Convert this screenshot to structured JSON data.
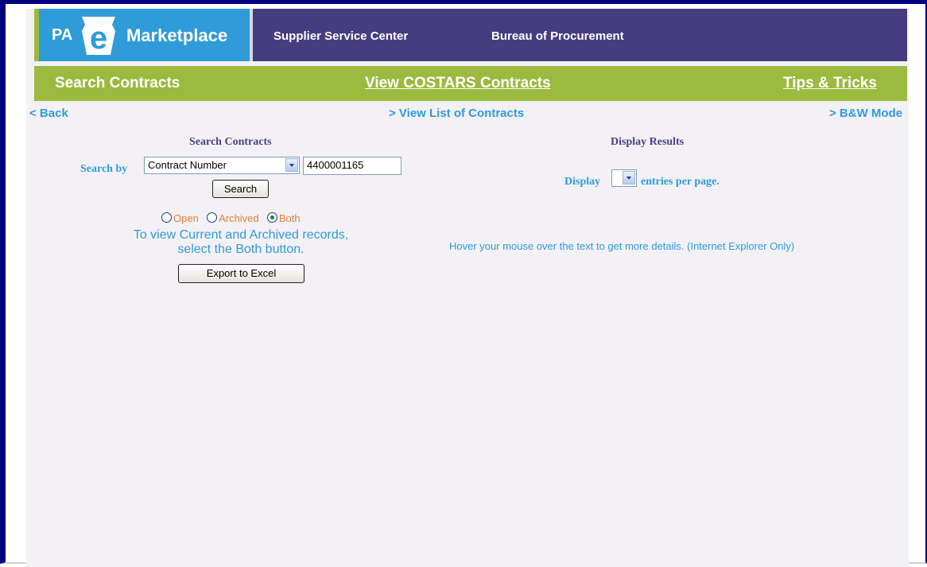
{
  "header": {
    "logo_pa": "PA",
    "logo_e": "e",
    "logo_marketplace": "Marketplace",
    "supplier_service_center": "Supplier Service Center",
    "bureau_of_procurement": "Bureau of Procurement"
  },
  "greenbar": {
    "search_contracts": "Search Contracts",
    "view_costars": "View COSTARS Contracts",
    "tips_tricks": "Tips & Tricks"
  },
  "subnav": {
    "back": "< Back",
    "view_list": "> View List of Contracts",
    "bw_mode": "> B&W Mode"
  },
  "search": {
    "heading": "Search Contracts",
    "search_by_label": "Search by",
    "search_by_value": "Contract Number",
    "input_value": "4400001165",
    "search_button": "Search",
    "radio_open": "Open",
    "radio_archived": "Archived",
    "radio_both": "Both",
    "selected_radio": "Both",
    "info_line1": "To view Current and Archived records,",
    "info_line2": "select the Both button.",
    "export_button": "Export to Excel"
  },
  "display": {
    "heading": "Display Results",
    "display_label": "Display",
    "entries_label": "entries per page.",
    "hover_note": "Hover your mouse over the text to get more details. (Internet Explorer Only)"
  },
  "colors": {
    "frame": "#000080",
    "header_bg": "#453d7f",
    "logo_bg": "#2f9bd8",
    "green_bar": "#9bba3f",
    "link_blue": "#2f9bd8",
    "radio_text": "#e57d2f"
  }
}
